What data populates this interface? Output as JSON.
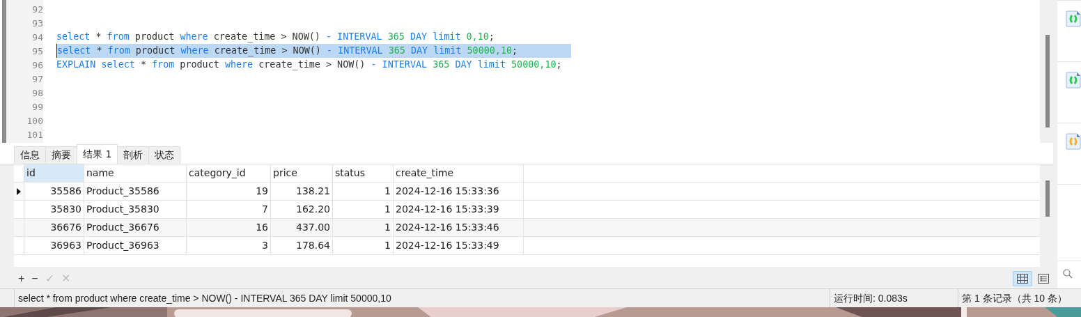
{
  "editor": {
    "lines": [
      {
        "number": "92",
        "selected": false
      },
      {
        "number": "93",
        "selected": false
      },
      {
        "number": "94",
        "selected": false,
        "tokens": [
          {
            "kind": "keyword",
            "text": "select"
          },
          {
            "kind": "plain",
            "text": " * "
          },
          {
            "kind": "keyword",
            "text": "from"
          },
          {
            "kind": "plain",
            "text": " product "
          },
          {
            "kind": "keyword",
            "text": "where"
          },
          {
            "kind": "plain",
            "text": " create_time > NOW() "
          },
          {
            "kind": "keyword",
            "text": "- INTERVAL"
          },
          {
            "kind": "number",
            "text": " 365 "
          },
          {
            "kind": "keyword",
            "text": "DAY limit"
          },
          {
            "kind": "number",
            "text": " 0,10"
          },
          {
            "kind": "plain",
            "text": ";"
          }
        ]
      },
      {
        "number": "95",
        "selected": true,
        "tokens": [
          {
            "kind": "keyword",
            "text": "select"
          },
          {
            "kind": "plain",
            "text": " * "
          },
          {
            "kind": "keyword",
            "text": "from"
          },
          {
            "kind": "plain",
            "text": " product "
          },
          {
            "kind": "keyword",
            "text": "where"
          },
          {
            "kind": "plain",
            "text": " create_time > NOW() "
          },
          {
            "kind": "keyword",
            "text": "- INTERVAL"
          },
          {
            "kind": "number",
            "text": " 365 "
          },
          {
            "kind": "keyword",
            "text": "DAY limit"
          },
          {
            "kind": "number",
            "text": " 50000,10"
          },
          {
            "kind": "plain",
            "text": ";"
          }
        ]
      },
      {
        "number": "96",
        "selected": false,
        "tokens": [
          {
            "kind": "keyword",
            "text": "EXPLAIN select"
          },
          {
            "kind": "plain",
            "text": " * "
          },
          {
            "kind": "keyword",
            "text": "from"
          },
          {
            "kind": "plain",
            "text": " product "
          },
          {
            "kind": "keyword",
            "text": "where"
          },
          {
            "kind": "plain",
            "text": " create_time > NOW() "
          },
          {
            "kind": "keyword",
            "text": "- INTERVAL"
          },
          {
            "kind": "number",
            "text": " 365 "
          },
          {
            "kind": "keyword",
            "text": "DAY limit"
          },
          {
            "kind": "number",
            "text": " 50000,10"
          },
          {
            "kind": "plain",
            "text": ";"
          }
        ]
      },
      {
        "number": "97",
        "selected": false
      },
      {
        "number": "98",
        "selected": false
      },
      {
        "number": "99",
        "selected": false
      },
      {
        "number": "100",
        "selected": false
      },
      {
        "number": "101",
        "selected": false
      }
    ]
  },
  "tabs": [
    {
      "label": "信息",
      "selected": false
    },
    {
      "label": "摘要",
      "selected": false
    },
    {
      "label": "结果 1",
      "selected": true
    },
    {
      "label": "剖析",
      "selected": false
    },
    {
      "label": "状态",
      "selected": false
    }
  ],
  "table": {
    "columns": [
      {
        "label": "id",
        "selected": true
      },
      {
        "label": "name",
        "selected": false
      },
      {
        "label": "category_id",
        "selected": false
      },
      {
        "label": "price",
        "selected": false
      },
      {
        "label": "status",
        "selected": false
      },
      {
        "label": "create_time",
        "selected": false
      }
    ],
    "rows": [
      {
        "current": true,
        "cells": [
          "35586",
          "Product_35586",
          "19",
          "138.21",
          "1",
          "2024-12-16 15:33:36"
        ]
      },
      {
        "current": false,
        "cells": [
          "35830",
          "Product_35830",
          "7",
          "162.20",
          "1",
          "2024-12-16 15:33:39"
        ]
      },
      {
        "current": false,
        "cells": [
          "36676",
          "Product_36676",
          "16",
          "437.00",
          "1",
          "2024-12-16 15:33:46"
        ]
      },
      {
        "current": false,
        "cells": [
          "36963",
          "Product_36963",
          "3",
          "178.64",
          "1",
          "2024-12-16 15:33:49"
        ]
      }
    ]
  },
  "toolbar": [
    {
      "label": "+",
      "disabled": false
    },
    {
      "label": "−",
      "disabled": false
    },
    {
      "label": "✓",
      "disabled": true
    },
    {
      "label": "✕",
      "disabled": true
    }
  ],
  "view_toggle": [
    {
      "kind": "grid",
      "selected": true
    },
    {
      "kind": "form",
      "selected": false
    }
  ],
  "side_icons": [
    {
      "color": "#2ecc55"
    },
    {
      "color": "#2ecc55"
    },
    {
      "color": "#f0b429"
    }
  ],
  "status_bar": {
    "query": "select * from product where create_time > NOW() - INTERVAL 365 DAY limit 50000,10",
    "run_time": "运行时间: 0.083s",
    "records": "第 1 条记录（共 10 条）"
  }
}
